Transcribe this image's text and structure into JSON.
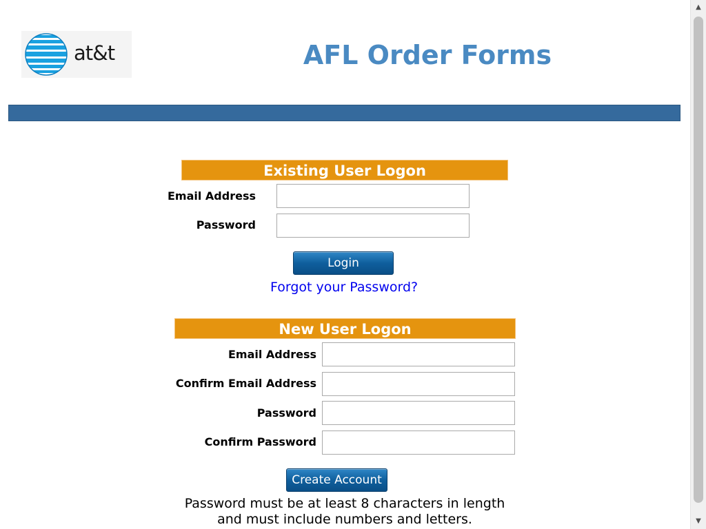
{
  "header": {
    "logo_text": "at&t",
    "title": "AFL Order Forms"
  },
  "existing_user": {
    "heading": "Existing User Logon",
    "email_label": "Email Address",
    "email_value": "",
    "password_label": "Password",
    "password_value": "",
    "login_button": "Login",
    "forgot_link": "Forgot your Password?"
  },
  "new_user": {
    "heading": "New User Logon",
    "email_label": "Email Address",
    "email_value": "",
    "confirm_email_label": "Confirm Email Address",
    "confirm_email_value": "",
    "password_label": "Password",
    "password_value": "",
    "confirm_password_label": "Confirm Password",
    "confirm_password_value": "",
    "create_button": "Create Account",
    "note_line1": "Password must be at least 8 characters in length",
    "note_line2": "and must include numbers and letters."
  },
  "colors": {
    "title": "#4a8ac2",
    "bar": "#356a9d",
    "section_header": "#e5940f",
    "button": "#0f5f9d",
    "link": "#0000ee"
  },
  "icons": {
    "logo": "att-globe-icon",
    "scroll_up": "chevron-up-icon",
    "scroll_down": "chevron-down-icon"
  }
}
